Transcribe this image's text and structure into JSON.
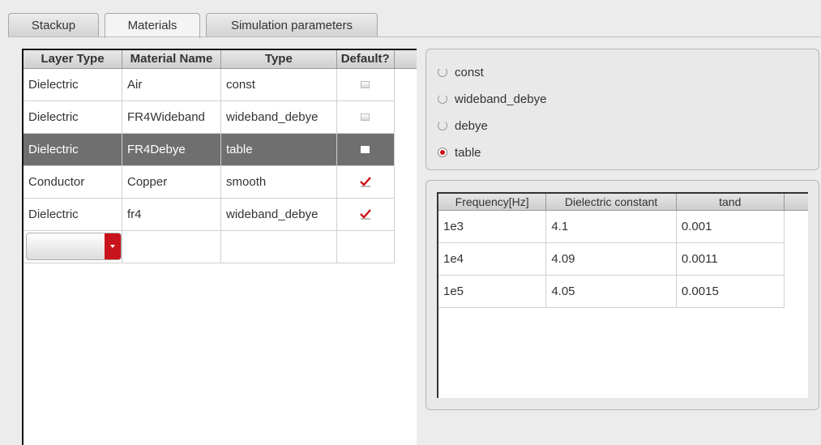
{
  "tabs": [
    {
      "label": "Stackup",
      "active": false
    },
    {
      "label": "Materials",
      "active": true
    },
    {
      "label": "Simulation parameters",
      "active": false
    }
  ],
  "materials_table": {
    "headers": [
      "Layer Type",
      "Material Name",
      "Type",
      "Default?"
    ],
    "rows": [
      {
        "layer_type": "Dielectric",
        "material_name": "Air",
        "type": "const",
        "default": false,
        "selected": false
      },
      {
        "layer_type": "Dielectric",
        "material_name": "FR4Wideband",
        "type": "wideband_debye",
        "default": false,
        "selected": false
      },
      {
        "layer_type": "Dielectric",
        "material_name": "FR4Debye",
        "type": "table",
        "default": false,
        "selected": true
      },
      {
        "layer_type": "Conductor",
        "material_name": "Copper",
        "type": "smooth",
        "default": true,
        "selected": false
      },
      {
        "layer_type": "Dielectric",
        "material_name": "fr4",
        "type": "wideband_debye",
        "default": true,
        "selected": false
      }
    ],
    "new_row_dropdown_value": ""
  },
  "type_options": [
    {
      "label": "const",
      "selected": false
    },
    {
      "label": "wideband_debye",
      "selected": false
    },
    {
      "label": "debye",
      "selected": false
    },
    {
      "label": "table",
      "selected": true
    }
  ],
  "freq_table": {
    "headers": [
      "Frequency[Hz]",
      "Dielectric constant",
      "tand"
    ],
    "rows": [
      [
        "1e3",
        "4.1",
        "0.001"
      ],
      [
        "1e4",
        "4.09",
        "0.0011"
      ],
      [
        "1e5",
        "4.05",
        "0.0015"
      ]
    ]
  },
  "colors": {
    "accent": "#c8141c",
    "selected_row": "#6f6f6f",
    "check": "#d0101a"
  }
}
